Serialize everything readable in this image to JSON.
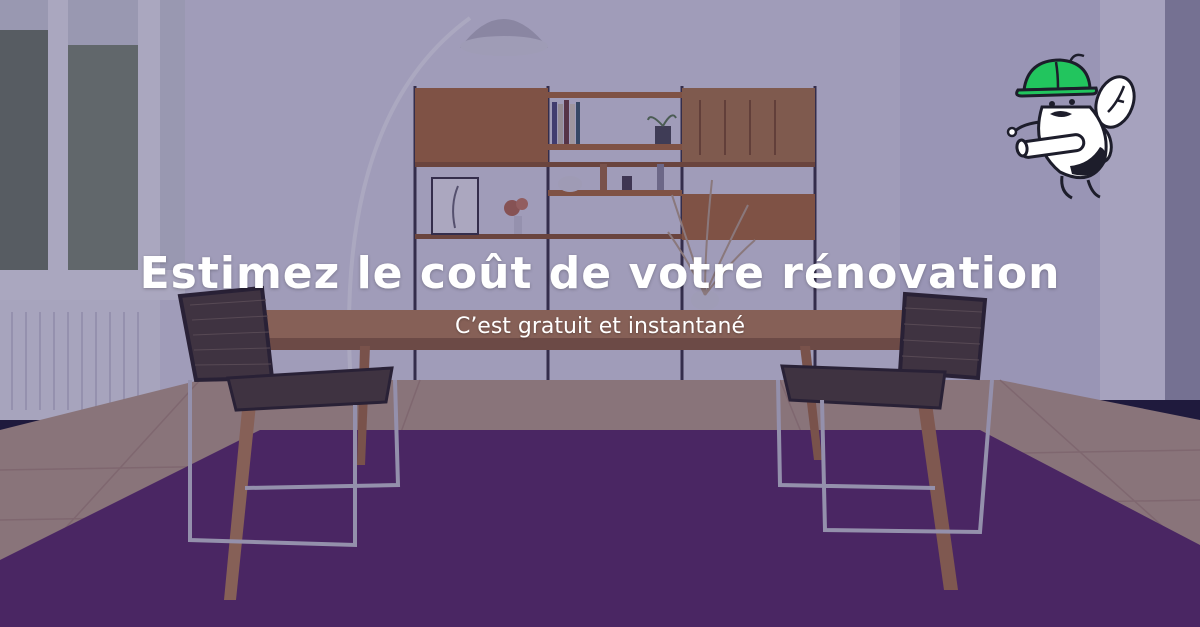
{
  "hero": {
    "title": "Estimez le coût de votre rénovation",
    "subtitle": "C’est gratuit et instantané"
  },
  "mascot": {
    "icon": "bee-worker-icon",
    "helmet_color": "#22c55e"
  },
  "colors": {
    "overlay": "#2a1f5a",
    "rug": "#5b2a68",
    "text": "#ffffff"
  }
}
